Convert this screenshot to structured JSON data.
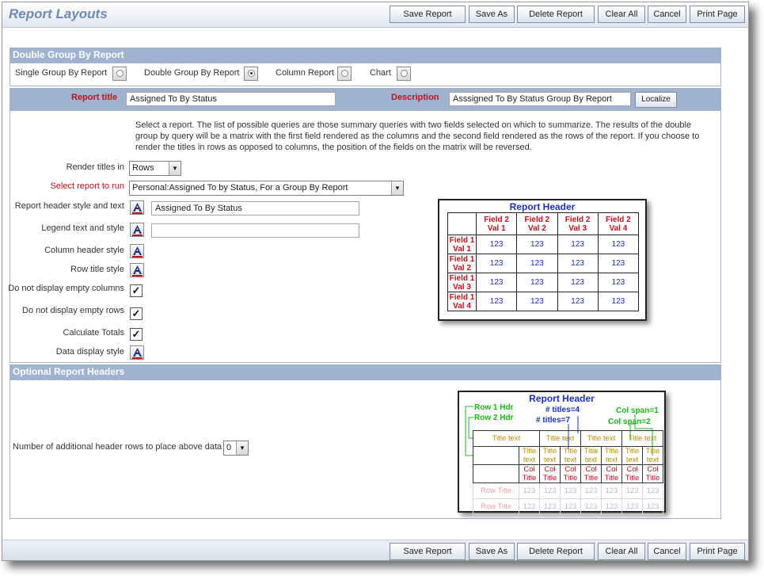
{
  "header": {
    "title": "Report Layouts"
  },
  "toolbar": [
    "Save Report",
    "Save As",
    "Delete Report",
    "Clear All",
    "Cancel",
    "Print Page"
  ],
  "type_section": {
    "title": "Double Group By Report",
    "options": [
      {
        "label": "Single Group By Report",
        "selected": false
      },
      {
        "label": "Double Group By Report",
        "selected": true
      },
      {
        "label": "Column Report",
        "selected": false
      },
      {
        "label": "Chart",
        "selected": false
      }
    ]
  },
  "title_row": {
    "report_title_label": "Report title",
    "report_title_value": "Assigned To By Status",
    "description_label": "Description",
    "description_value": "Asssigned To By Status Group By Report",
    "localize_label": "Localize"
  },
  "help_text": "Select a report. The list of possible queries are those summary queries with two fields selected on which to summarize. The results of the double group by query will be a matrix with the first field rendered as the columns and the second field rendered as the rows of the report. If you choose to render the titles in rows as opposed to columns, the position of the fields on the matrix will be reversed.",
  "form": {
    "render_titles_label": "Render titles in",
    "render_titles_value": "Rows",
    "select_report_label": "Select report to run",
    "select_report_value": "Personal:Assigned To by Status, For a Group By Report",
    "header_style_label": "Report header style and text",
    "header_style_value": "Assigned To By Status",
    "legend_label": "Legend text and style",
    "legend_value": "",
    "column_header_label": "Column header style",
    "row_title_label": "Row title style",
    "empty_columns_label": "Do not display empty columns",
    "empty_columns_checked": true,
    "empty_rows_label": "Do not display empty rows",
    "empty_rows_checked": true,
    "calc_totals_label": "Calculate Totals",
    "calc_totals_checked": true,
    "data_style_label": "Data display style"
  },
  "preview1": {
    "title": "Report Header",
    "col_headers": [
      [
        "Field 2",
        "Val 1"
      ],
      [
        "Field 2",
        "Val 2"
      ],
      [
        "Field 2",
        "Val 3"
      ],
      [
        "Field 2",
        "Val 4"
      ]
    ],
    "row_headers": [
      [
        "Field 1",
        "Val 1"
      ],
      [
        "Field 1",
        "Val 2"
      ],
      [
        "Field 1",
        "Val 3"
      ],
      [
        "Field 1",
        "Val 4"
      ]
    ],
    "value": "123"
  },
  "optional_section": {
    "title": "Optional Report Headers",
    "rows_label": "Number of additional header rows to place above data",
    "rows_value": "0"
  },
  "preview2": {
    "title": "Report Header",
    "row1_hdr": "Row 1 Hdr",
    "row2_hdr": "Row 2 Hdr",
    "titles4": "# titles=4",
    "titles7": "# titles=7",
    "colspan1": "Col span=1",
    "colspan2": "Col span=2",
    "title_text": "Title text",
    "title_word": "Title",
    "text_word": "text",
    "col_word": "Col",
    "row_title": "Row Title",
    "value": "123"
  },
  "colors": {
    "section_header": "#9fb2cf",
    "label_red": "#c0121b",
    "preview_blue": "#1b2fc4",
    "title_gold": "#b98d00",
    "annot_green": "#15b815"
  }
}
